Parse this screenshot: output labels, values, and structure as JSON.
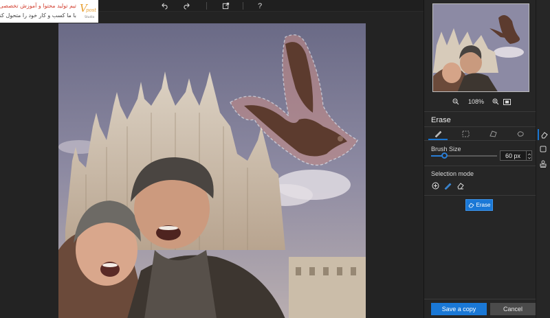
{
  "watermark": {
    "line1": "تیم تولید محتوا و آموزش تخصصی",
    "line2": "با ما کسب و کار خود را متحول کنید",
    "brand": "Vpost Studio"
  },
  "toolbar": {
    "undo_icon": "undo-icon",
    "redo_icon": "redo-icon",
    "share_icon": "share-icon",
    "help_label": "?"
  },
  "panel": {
    "zoom_value": "108%",
    "section_title": "Erase",
    "brush_size_label": "Brush Size",
    "brush_size_value": "60 px",
    "brush_size_fraction": 0.2,
    "selection_mode_label": "Selection mode",
    "erase_button": "Erase",
    "save_button": "Save a copy",
    "cancel_button": "Cancel"
  },
  "colors": {
    "accent": "#1a78d6",
    "selection_tint": "#c88b85"
  }
}
